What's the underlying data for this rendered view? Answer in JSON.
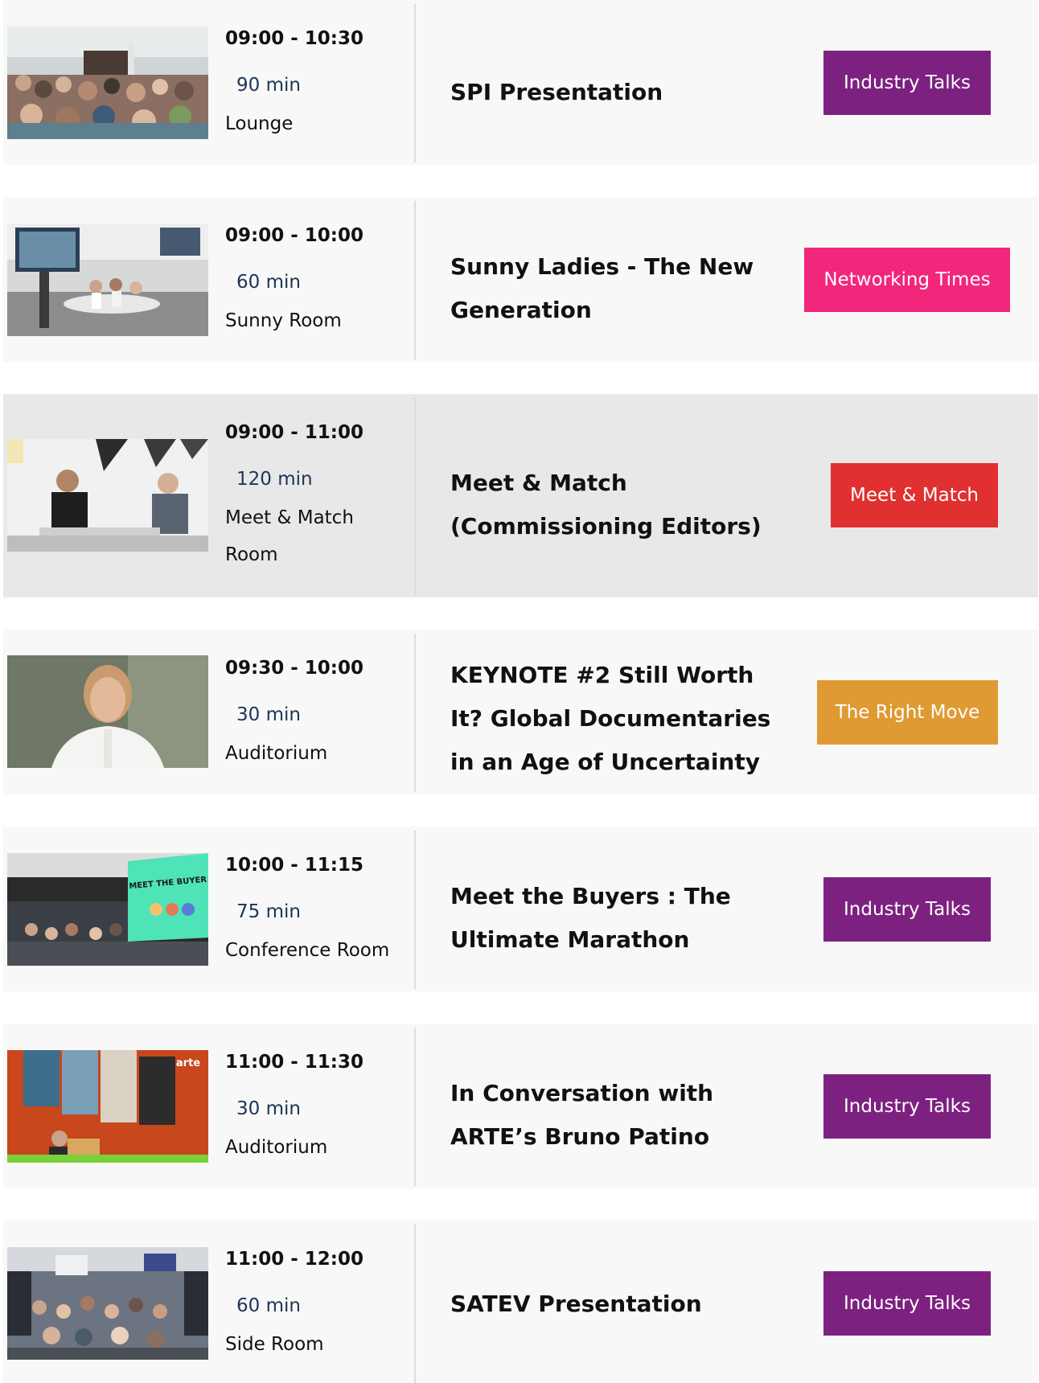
{
  "colors": {
    "industry_talks": "#7d2181",
    "networking_times": "#f2267a",
    "meet_match": "#e0302f",
    "right_move": "#e09a33"
  },
  "sessions": [
    {
      "time": "09:00 - 10:30",
      "duration": "90 min",
      "room": "Lounge",
      "title": "SPI Presentation",
      "tag": "Industry Talks",
      "image": "audience-photo"
    },
    {
      "time": "09:00 - 10:00",
      "duration": "60 min",
      "room": "Sunny Room",
      "title": "Sunny Ladies - The New Generation",
      "tag": "Networking Times",
      "image": "panel-photo"
    },
    {
      "time": "09:00 - 11:00",
      "duration": "120 min",
      "room": "Meet & Match Room",
      "title": "Meet & Match (Commissioning Editors)",
      "tag": "Meet & Match",
      "image": "meeting-photo"
    },
    {
      "time": "09:30 - 10:00",
      "duration": "30 min",
      "room": "Auditorium",
      "title": "KEYNOTE #2 Still Worth It? Global Documentaries in an Age of Uncertainty",
      "tag": "The Right Move",
      "image": "portrait-photo"
    },
    {
      "time": "10:00 - 11:15",
      "duration": "75 min",
      "room": "Conference Room",
      "title": "Meet the Buyers : The Ultimate Marathon",
      "tag": "Industry Talks",
      "image": "conference-photo",
      "screen_text": "MEET THE BUYER"
    },
    {
      "time": "11:00 - 11:30",
      "duration": "30 min",
      "room": "Auditorium",
      "title": "In Conversation with ARTE’s Bruno Patino",
      "tag": "Industry Talks",
      "image": "speaker-photo",
      "screen_text": "arte"
    },
    {
      "time": "11:00 - 12:00",
      "duration": "60 min",
      "room": "Side Room",
      "title": "SATEV Presentation",
      "tag": "Industry Talks",
      "image": "side-room-photo"
    }
  ]
}
